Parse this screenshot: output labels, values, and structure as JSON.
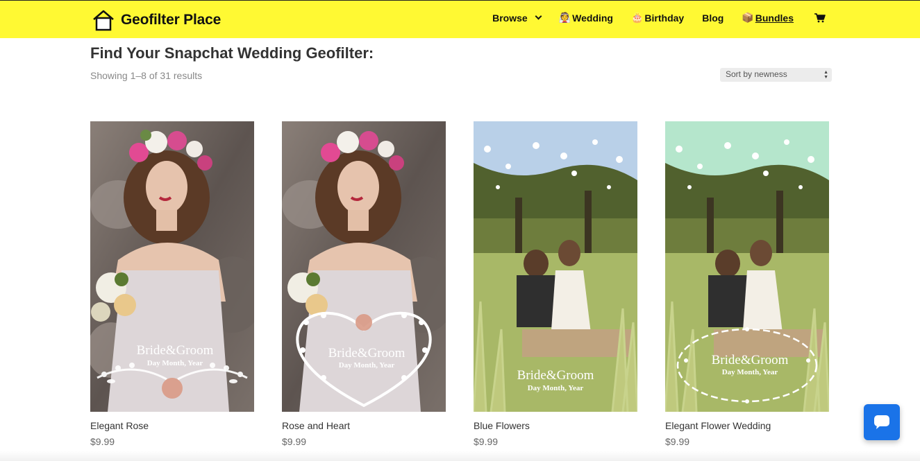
{
  "header": {
    "logo_text": "Geofilter Place",
    "logo_icon": "house-icon",
    "nav": [
      {
        "label": "Browse",
        "icon": "chevron-down-icon"
      },
      {
        "label": "Wedding",
        "emoji": "👰"
      },
      {
        "label": "Birthday",
        "emoji": "🎂"
      },
      {
        "label": "Blog"
      },
      {
        "label": "Bundles",
        "emoji": "📦"
      }
    ],
    "cart_icon": "cart-icon",
    "bg_color": "#fff933"
  },
  "main": {
    "title": "Find Your Snapchat Wedding Geofilter:",
    "result_count": "Showing 1–8 of 31 results",
    "sort": {
      "selected": "Sort by newness"
    }
  },
  "products": [
    {
      "name": "Elegant Rose",
      "price": "$9.99",
      "overlay_title": "Bride&Groom",
      "overlay_sub": "Day Month, Year"
    },
    {
      "name": "Rose and Heart",
      "price": "$9.99",
      "overlay_title": "Bride&Groom",
      "overlay_sub": "Day Month, Year"
    },
    {
      "name": "Blue Flowers",
      "price": "$9.99",
      "overlay_title": "Bride&Groom",
      "overlay_sub": "Day Month, Year"
    },
    {
      "name": "Elegant Flower Wedding",
      "price": "$9.99",
      "overlay_title": "Bride&Groom",
      "overlay_sub": "Day Month, Year"
    }
  ],
  "chat": {
    "icon": "chat-bubble-icon",
    "color": "#1a73e8"
  }
}
